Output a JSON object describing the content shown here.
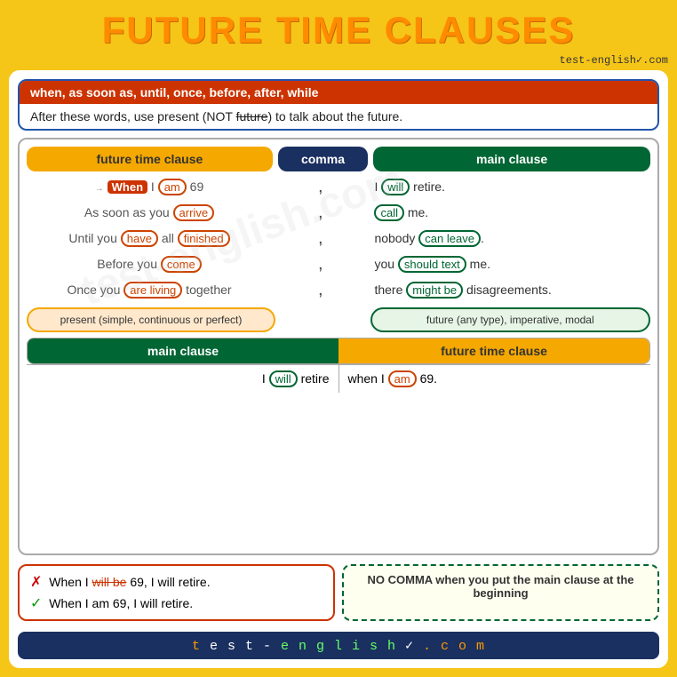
{
  "title": "FUTURE TIME CLAUSES",
  "website": "test-english",
  "website_suffix": ".com",
  "info_header": "when, as soon as, until, once, before, after, while",
  "info_body_1": "After these words, use present (NOT ",
  "info_body_future": "future",
  "info_body_2": ") to talk about the future.",
  "table_headers": {
    "future_time_clause": "future time clause",
    "comma": "comma",
    "main_clause": "main clause"
  },
  "table_rows": [
    {
      "future": "When I am 69",
      "future_when": "When",
      "future_rest": " I ",
      "future_pill": "am",
      "future_end": " 69",
      "comma": ",",
      "main": "I ",
      "main_pill": "will",
      "main_end": " retire."
    },
    {
      "future": "As soon as you arrive",
      "future_prefix": "As soon as you ",
      "future_pill": "arrive",
      "comma": ",",
      "main": "",
      "main_pill": "call",
      "main_end": " me."
    },
    {
      "future": "Until you have all finished",
      "future_prefix": "Until you ",
      "future_pill1": "have",
      "future_mid": " all ",
      "future_pill2": "finished",
      "comma": ",",
      "main": "nobody ",
      "main_pill": "can leave",
      "main_end": "."
    },
    {
      "future": "Before you come",
      "future_prefix": "Before you ",
      "future_pill": "come",
      "comma": ",",
      "main": "you ",
      "main_pill": "should text",
      "main_end": " me."
    },
    {
      "future": "Once you are living together",
      "future_prefix": "Once you ",
      "future_pill": "are living",
      "future_end": " together",
      "comma": ",",
      "main": "there ",
      "main_pill": "might be",
      "main_end": " disagreements."
    }
  ],
  "label_left": "present (simple, continuous or perfect)",
  "label_right": "future (any type), imperative, modal",
  "bottom_headers": {
    "main_clause": "main clause",
    "future_time_clause": "future time clause"
  },
  "bottom_row": {
    "main": "I ",
    "main_pill": "will",
    "main_end": " retire",
    "future": "when I ",
    "future_pill": "am",
    "future_end": " 69."
  },
  "no_comma_text": "NO COMMA when you put the main clause at the beginning",
  "example_wrong_prefix": "When I ",
  "example_wrong_strike": "will be",
  "example_wrong_end": " 69, I will retire.",
  "example_correct": "When I am 69, I will retire.",
  "footer": "t e s t - e n g l i s h",
  "footer_suffix": " . c o m"
}
